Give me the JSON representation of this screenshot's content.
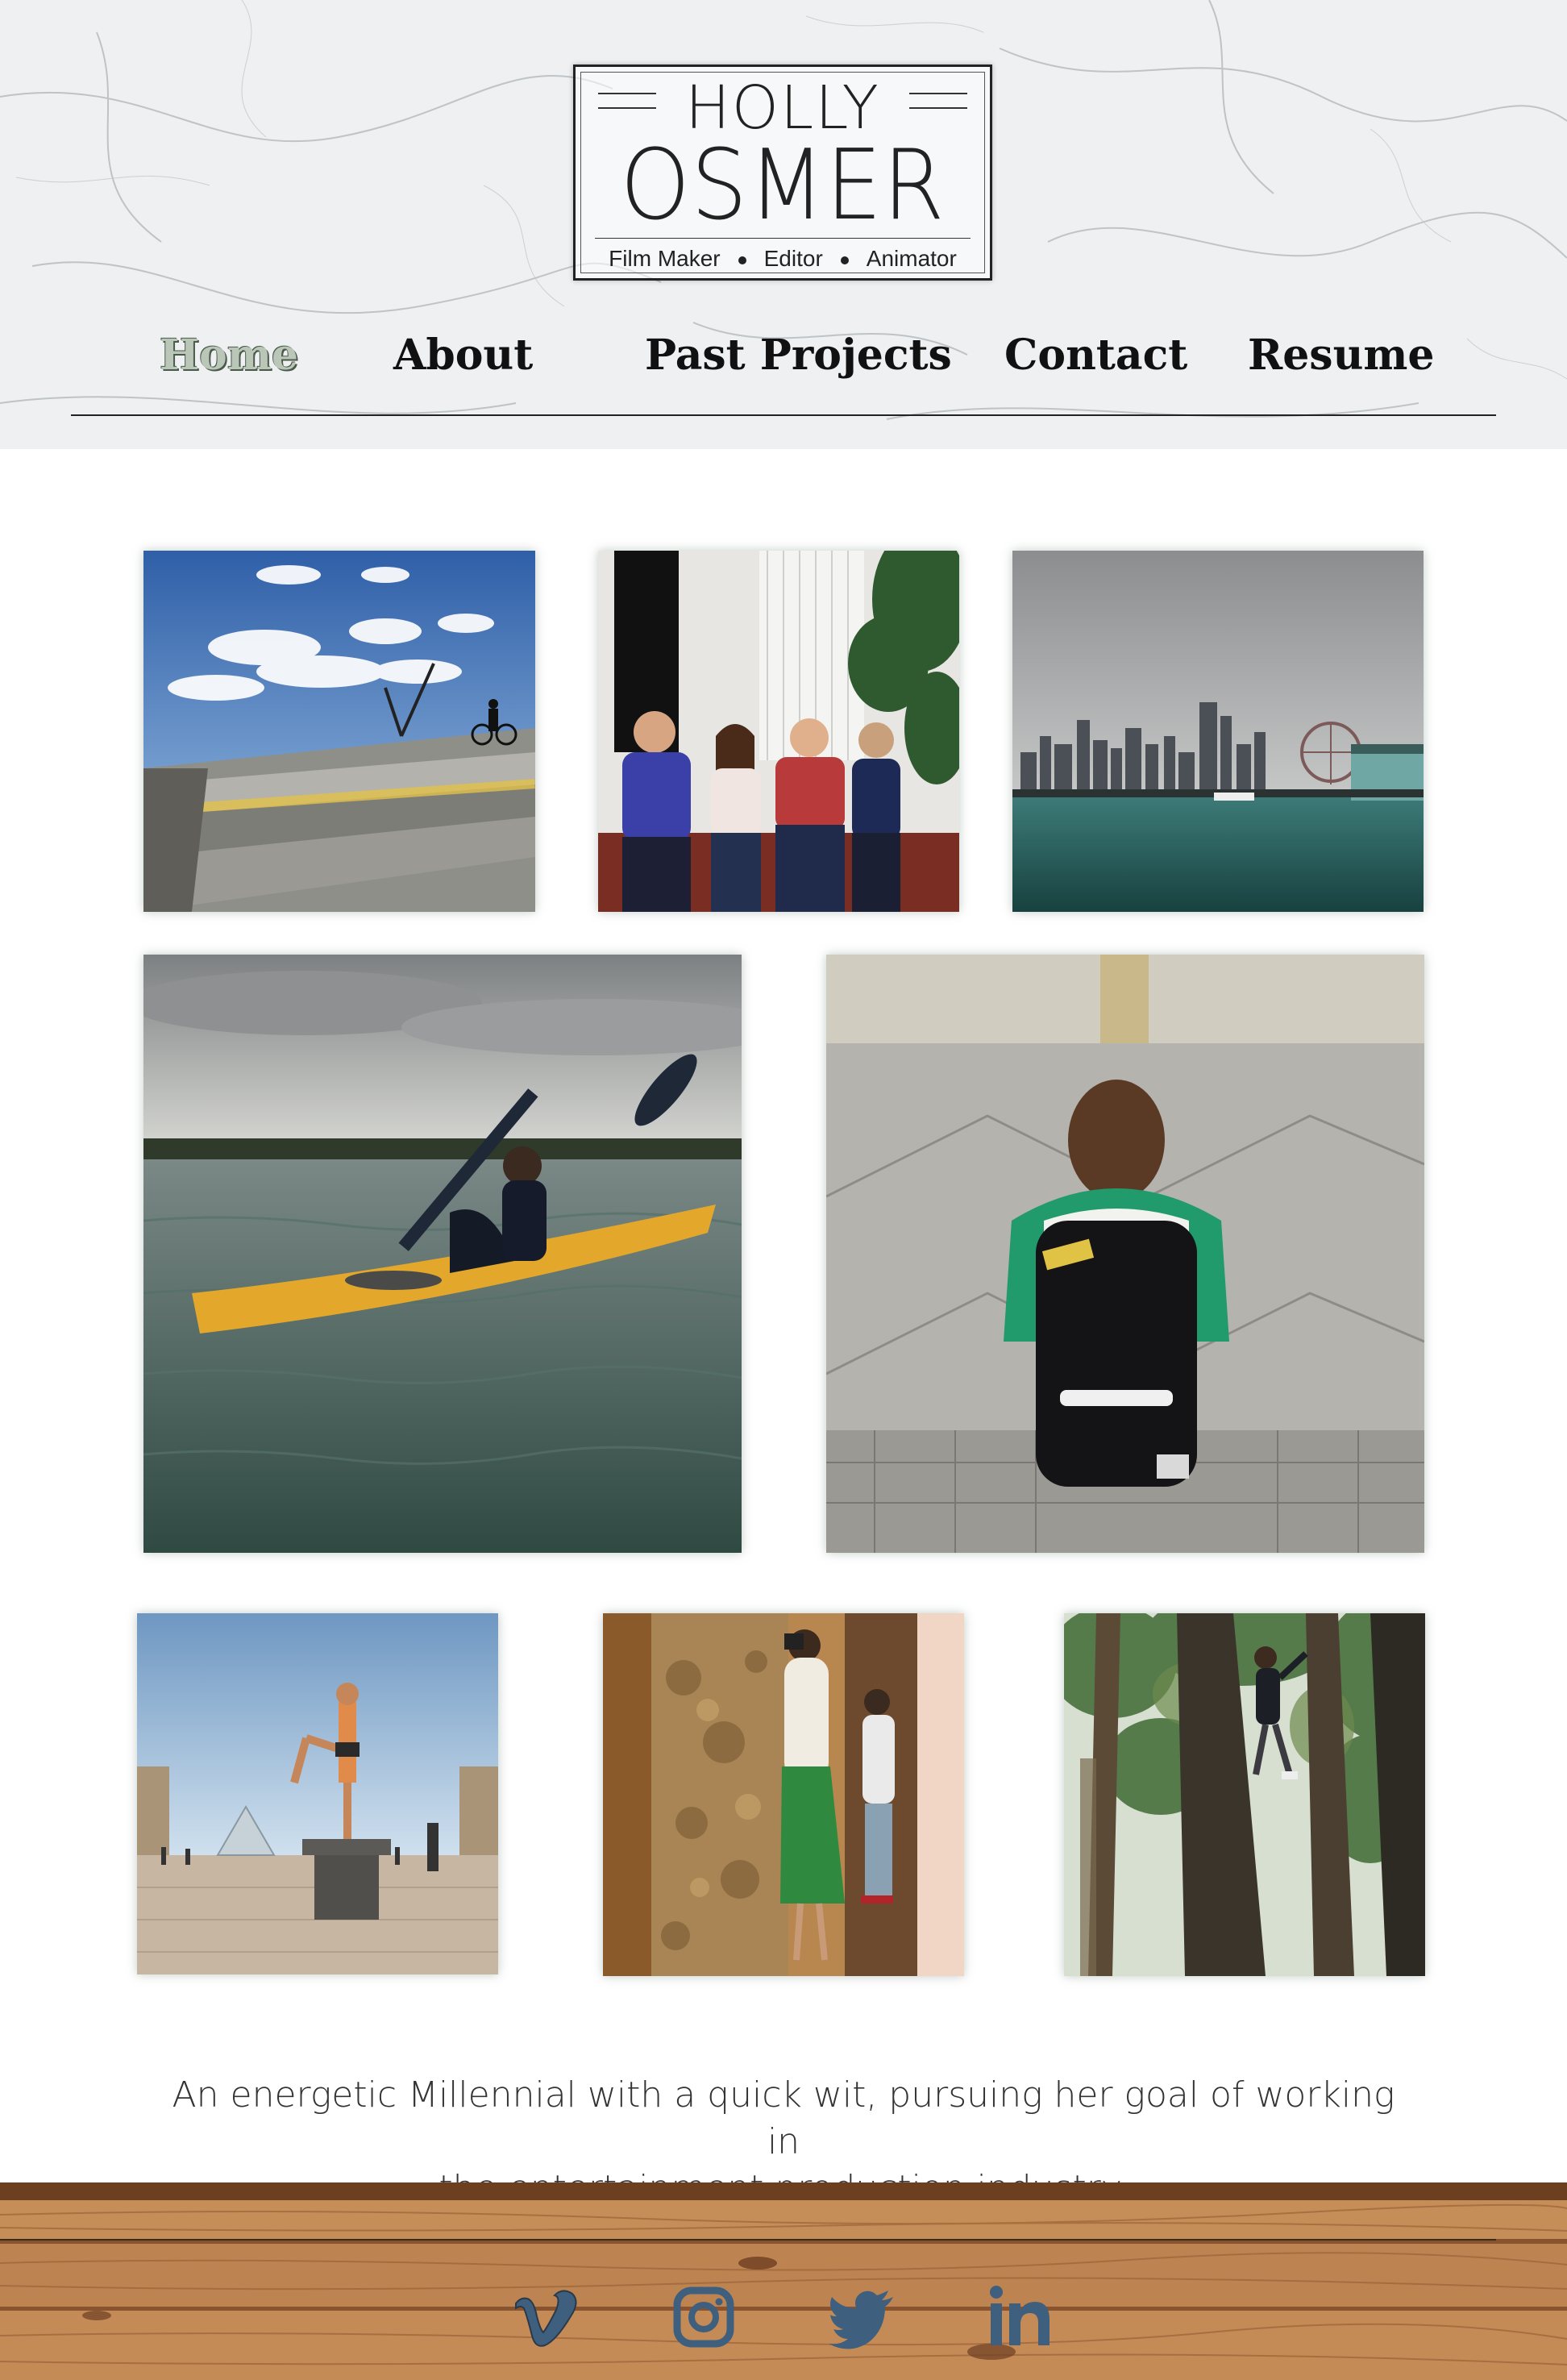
{
  "site": {
    "logo": {
      "first_name": "HOLLY",
      "last_name": "OSMER",
      "roles": [
        "Film Maker",
        "Editor",
        "Animator"
      ]
    }
  },
  "nav": {
    "items": [
      {
        "label": "Home",
        "active": true
      },
      {
        "label": "About",
        "active": false
      },
      {
        "label": "Past Projects",
        "active": false
      },
      {
        "label": "Contact",
        "active": false
      },
      {
        "label": "Resume",
        "active": false
      }
    ],
    "active_color": "#b9c6b8"
  },
  "gallery": {
    "photos": [
      {
        "subject": "steps-and-cyclist"
      },
      {
        "subject": "group-on-couch"
      },
      {
        "subject": "city-skyline-harbor"
      },
      {
        "subject": "kayak-on-lake"
      },
      {
        "subject": "backpack-on-pavement"
      },
      {
        "subject": "pyramid-pose"
      },
      {
        "subject": "photographer-at-rock"
      },
      {
        "subject": "tree-climb"
      }
    ]
  },
  "tagline": {
    "line1": "An energetic Millennial with a quick wit, pursuing her goal of working in",
    "line2": "the entertainment production industry."
  },
  "footer": {
    "social": [
      {
        "icon": "vimeo-icon"
      },
      {
        "icon": "instagram-icon"
      },
      {
        "icon": "twitter-icon"
      },
      {
        "icon": "linkedin-icon"
      }
    ],
    "icon_color": "#3f5f7f"
  }
}
